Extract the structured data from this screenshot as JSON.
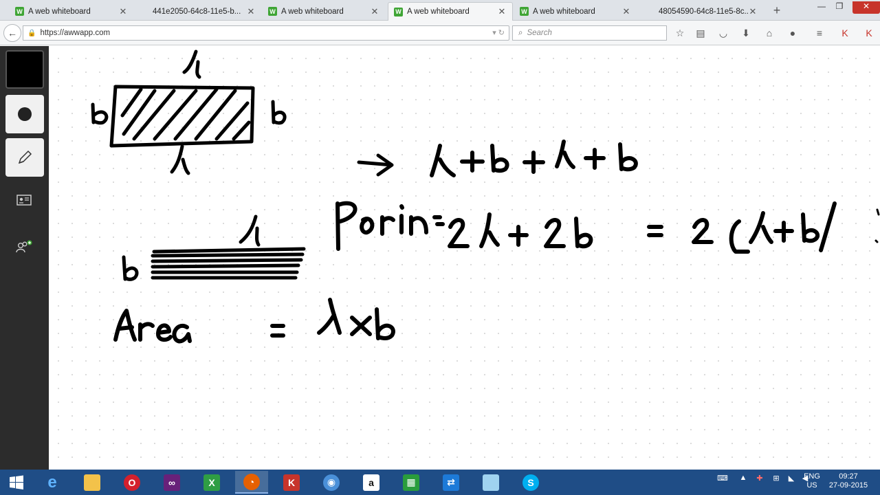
{
  "browser": {
    "tabs": [
      {
        "label": "A web whiteboard",
        "favicon": "W",
        "active": false
      },
      {
        "label": "441e2050-64c8-11e5-b...",
        "favicon": "",
        "active": false
      },
      {
        "label": "A web whiteboard",
        "favicon": "W",
        "active": false
      },
      {
        "label": "A web whiteboard",
        "favicon": "W",
        "active": true
      },
      {
        "label": "A web whiteboard",
        "favicon": "W",
        "active": false
      },
      {
        "label": "48054590-64c8-11e5-8c...",
        "favicon": "",
        "active": false
      }
    ],
    "new_tab": "+",
    "url": "https://awwapp.com",
    "search_placeholder": "Search"
  },
  "whiteboard": {
    "tools": [
      "color-swatch",
      "brush-size",
      "pen-tool",
      "board-info",
      "invite-users"
    ],
    "current_color": "#000000",
    "drawing_strokes": [
      "l",
      "b",
      "b",
      "l",
      "-> l+b+l+b",
      "l",
      "b",
      "Perim = 2l + 2b",
      "= 2(l+b)",
      "Area = l×b"
    ]
  },
  "taskbar": {
    "apps": [
      "start",
      "internet-explorer",
      "file-explorer",
      "opera",
      "visual-studio",
      "excel",
      "firefox",
      "kaspersky",
      "chrome",
      "amazon",
      "windows-store",
      "teamviewer",
      "notepad",
      "skype"
    ],
    "running_app": "firefox",
    "language": "ENG",
    "region": "US",
    "time": "09:27",
    "date": "27-09-2015"
  },
  "colors": {
    "accent_green": "#3fa535",
    "taskbar_blue": "#1f4d86",
    "close_red": "#c7342b",
    "sidebar_dark": "#2c2c2c"
  }
}
